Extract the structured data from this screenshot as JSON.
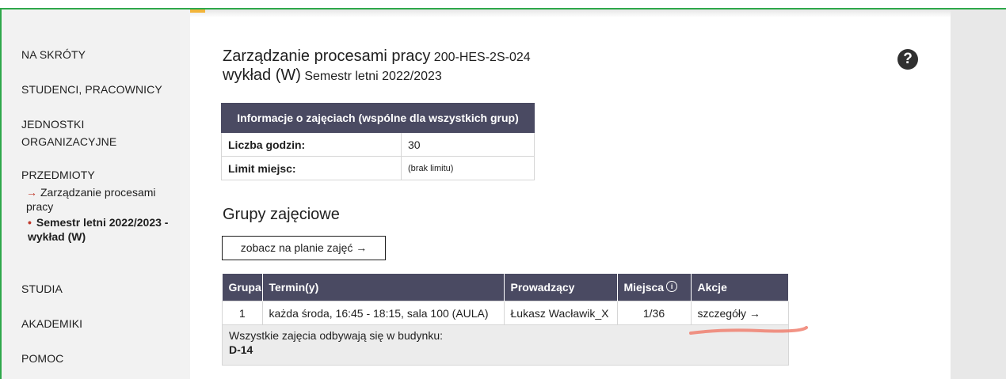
{
  "sidebar": {
    "items": [
      "NA SKRÓTY",
      "STUDENCI, PRACOWNICY",
      "JEDNOSTKI",
      "ORGANIZACYJNE",
      "PRZEDMIOTY",
      "STUDIA",
      "AKADEMIKI",
      "POMOC"
    ],
    "sub_link": "Zarządzanie procesami pracy",
    "sub_current": "Semestr letni 2022/2023 - wykład (W)"
  },
  "header": {
    "title": "Zarządzanie procesami pracy",
    "code": "200-HES-2S-024",
    "type": "wykład (W)",
    "semester": "Semestr letni 2022/2023"
  },
  "info_table": {
    "heading": "Informacje o zajęciach (wspólne dla wszystkich grup)",
    "rows": [
      {
        "label": "Liczba godzin:",
        "value": "30"
      },
      {
        "label": "Limit miejsc:",
        "value": "(brak limitu)"
      }
    ]
  },
  "groups": {
    "heading": "Grupy zajęciowe",
    "plan_button": "zobacz na planie zajęć →",
    "columns": [
      "Grupa",
      "Termin(y)",
      "Prowadzący",
      "Miejsca",
      "Akcje"
    ],
    "rows": [
      {
        "group": "1",
        "term": "każda środa, 16:45 - 18:15, sala 100 (AULA)",
        "teacher": "Łukasz Wacławik_X",
        "places": "1/36",
        "action": "szczegóły →"
      }
    ],
    "building_note": "Wszystkie zajęcia odbywają się w budynku:",
    "building": "D-14"
  },
  "icons": {
    "help": "question-circle-icon",
    "info": "info-circle-icon"
  },
  "colors": {
    "header_bg": "#4a4a62",
    "accent_green": "#2ea84a",
    "accent_orange": "#f2b53a",
    "marker": "#f08070"
  }
}
